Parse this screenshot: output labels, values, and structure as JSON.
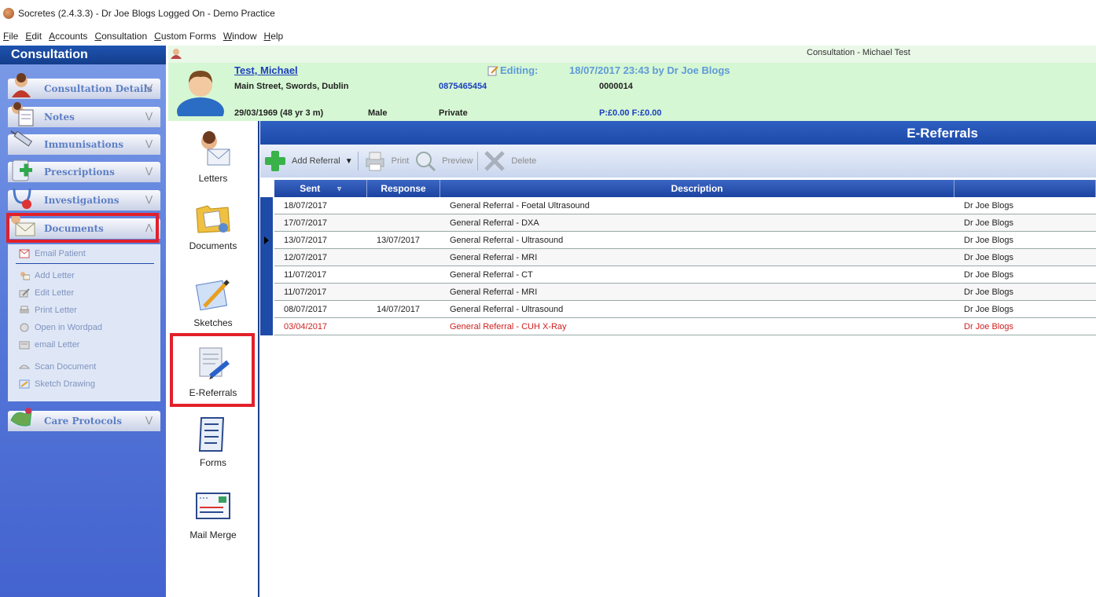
{
  "window": {
    "title": "Socretes (2.4.3.3) - Dr Joe Blogs Logged On - Demo Practice"
  },
  "menu": [
    "File",
    "Edit",
    "Accounts",
    "Consultation",
    "Custom Forms",
    "Window",
    "Help"
  ],
  "sidebar": {
    "header": "Consultation",
    "groups": [
      {
        "label": "Consultation Details",
        "icon": "consultation-icon"
      },
      {
        "label": "Notes",
        "icon": "notes-icon"
      },
      {
        "label": "Immunisations",
        "icon": "syringe-icon"
      },
      {
        "label": "Prescriptions",
        "icon": "prescription-icon"
      },
      {
        "label": "Investigations",
        "icon": "stethoscope-icon"
      },
      {
        "label": "Documents",
        "icon": "envelope-icon"
      },
      {
        "label": "Care Protocols",
        "icon": "care-protocols-icon"
      }
    ],
    "document_items": [
      "Email Patient",
      "Add Letter",
      "Edit Letter",
      "Print Letter",
      "Open in Wordpad",
      "email Letter",
      "Scan Document",
      "Sketch Drawing"
    ]
  },
  "patient": {
    "name": "Test, Michael",
    "address": "Main Street, Swords, Dublin",
    "dob": "29/03/1969 (48 yr 3 m)",
    "sex": "Male",
    "phone": "0875465454",
    "scheme": "Private",
    "editing_label": "Editing:",
    "editing_info": "18/07/2017 23:43 by Dr Joe Blogs",
    "patient_id": "0000014",
    "balance": "P:£0.00 F:£0.00",
    "window_label": "Consultation - Michael Test"
  },
  "tools": [
    "Letters",
    "Documents",
    "Sketches",
    "E-Referrals",
    "Forms",
    "Mail Merge"
  ],
  "ereferrals": {
    "title": "E-Referrals",
    "toolbar": {
      "add": "Add Referral",
      "print": "Print",
      "preview": "Preview",
      "delete": "Delete"
    },
    "columns": [
      "Sent",
      "Response",
      "Description",
      ""
    ],
    "rows": [
      {
        "sent": "18/07/2017",
        "response": "",
        "description": "General Referral - Foetal Ultrasound",
        "doctor": "Dr Joe Blogs"
      },
      {
        "sent": "17/07/2017",
        "response": "",
        "description": "General Referral - DXA",
        "doctor": "Dr Joe Blogs"
      },
      {
        "sent": "13/07/2017",
        "response": "13/07/2017",
        "description": "General Referral - Ultrasound",
        "doctor": "Dr Joe Blogs"
      },
      {
        "sent": "12/07/2017",
        "response": "",
        "description": "General Referral - MRI",
        "doctor": "Dr Joe Blogs"
      },
      {
        "sent": "11/07/2017",
        "response": "",
        "description": "General Referral - CT",
        "doctor": "Dr Joe Blogs"
      },
      {
        "sent": "11/07/2017",
        "response": "",
        "description": "General Referral - MRI",
        "doctor": "Dr Joe Blogs"
      },
      {
        "sent": "08/07/2017",
        "response": "14/07/2017",
        "description": "General Referral - Ultrasound",
        "doctor": "Dr Joe Blogs"
      },
      {
        "sent": "03/04/2017",
        "response": "",
        "description": "General Referral - CUH X-Ray",
        "doctor": "Dr Joe Blogs"
      }
    ]
  }
}
